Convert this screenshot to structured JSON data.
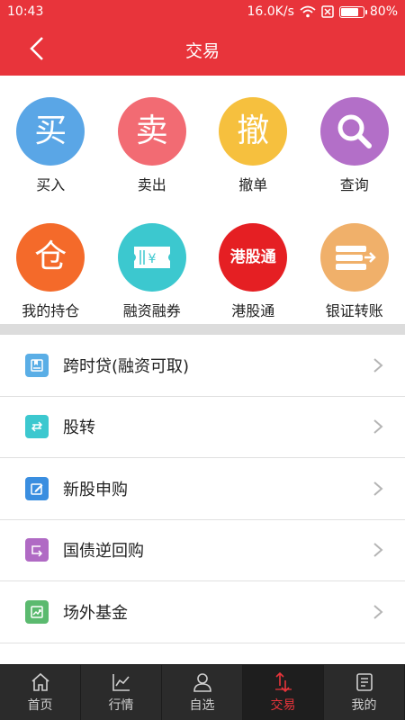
{
  "statusbar": {
    "time": "10:43",
    "speed": "16.0K/s",
    "battery": "80%",
    "battery_level": 0.8
  },
  "header": {
    "title": "交易"
  },
  "grid": {
    "items": [
      {
        "glyph": "买",
        "label": "买入",
        "color": "#5aa6e6"
      },
      {
        "glyph": "卖",
        "label": "卖出",
        "color": "#f26b73"
      },
      {
        "glyph": "撤",
        "label": "撤单",
        "color": "#f6c03e"
      },
      {
        "glyph": "",
        "label": "查询",
        "color": "#b36fc8",
        "icon": "search-icon"
      },
      {
        "glyph": "仓",
        "label": "我的持仓",
        "color": "#f46a2a"
      },
      {
        "glyph": "",
        "label": "融资融券",
        "color": "#3cc8cf",
        "icon": "ticket-icon"
      },
      {
        "glyph": "港股通",
        "label": "港股通",
        "color": "#e51f23"
      },
      {
        "glyph": "",
        "label": "银证转账",
        "color": "#f0b06a",
        "icon": "transfer-icon"
      }
    ]
  },
  "list": {
    "items": [
      {
        "label": "跨时贷(融资可取)",
        "color": "#5aaee6",
        "icon": "book-icon"
      },
      {
        "label": "股转",
        "color": "#3cc8cf",
        "icon": "swap-icon"
      },
      {
        "label": "新股申购",
        "color": "#3a8ee0",
        "icon": "edit-icon"
      },
      {
        "label": "国债逆回购",
        "color": "#b06ac4",
        "icon": "return-icon"
      },
      {
        "label": "场外基金",
        "color": "#5bba6f",
        "icon": "trend-icon"
      }
    ]
  },
  "tabs": [
    {
      "label": "首页",
      "icon": "home-icon"
    },
    {
      "label": "行情",
      "icon": "chart-icon"
    },
    {
      "label": "自选",
      "icon": "user-icon"
    },
    {
      "label": "交易",
      "icon": "trade-icon",
      "active": true
    },
    {
      "label": "我的",
      "icon": "document-icon"
    }
  ]
}
